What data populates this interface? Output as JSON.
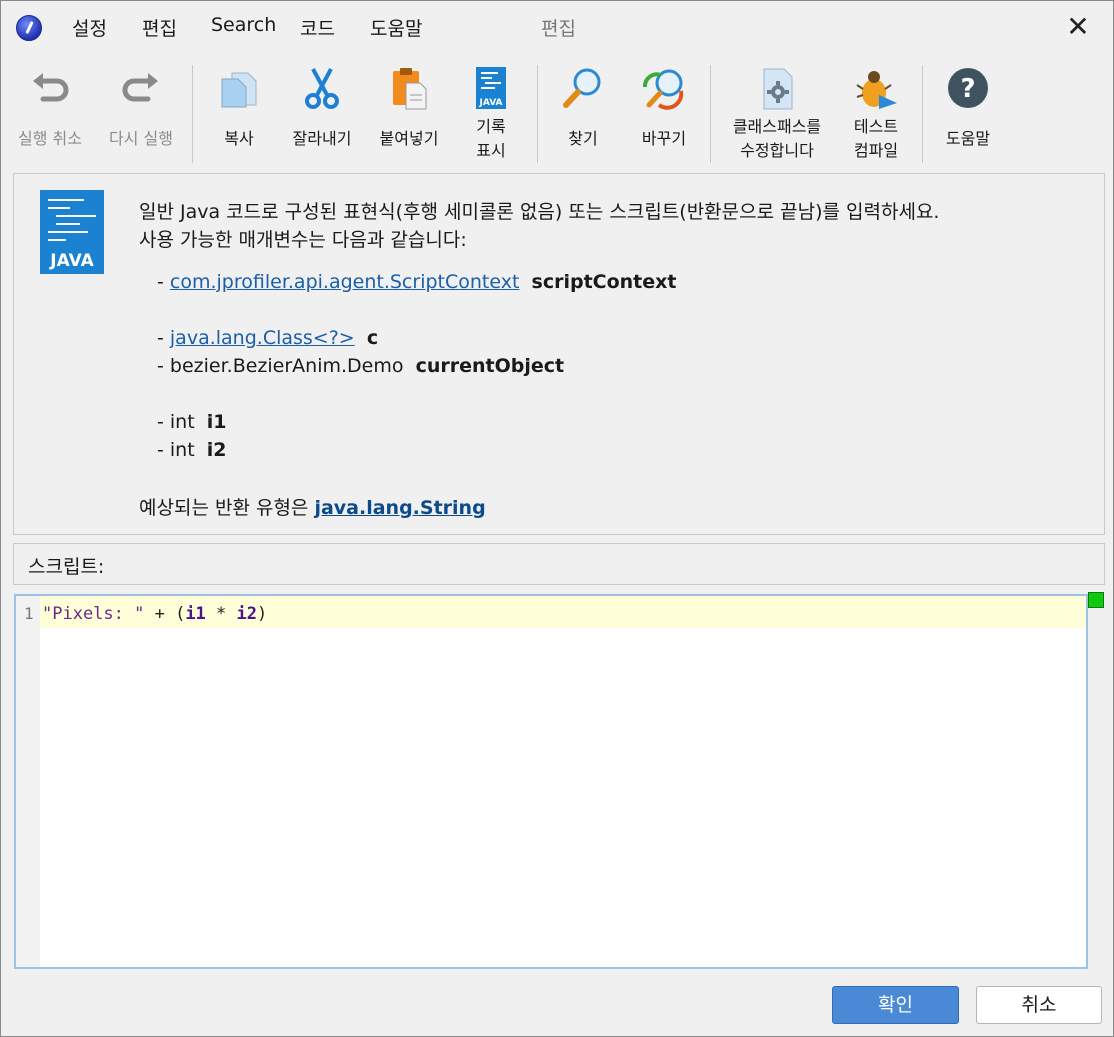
{
  "menu": {
    "items": [
      "설정",
      "편집",
      "Search",
      "코드",
      "도움말"
    ],
    "title": "편집"
  },
  "toolbar": {
    "undo": "실행 취소",
    "redo": "다시 실행",
    "copy": "복사",
    "cut": "잘라내기",
    "paste": "붙여넣기",
    "history_1": "기록",
    "history_2": "표시",
    "find": "찾기",
    "replace": "바꾸기",
    "classpath_1": "클래스패스를",
    "classpath_2": "수정합니다",
    "compile_1": "테스트",
    "compile_2": "컴파일",
    "help": "도움말",
    "java_icon_text": "JAVA"
  },
  "info": {
    "java_badge": "JAVA",
    "line1": "일반 Java 코드로 구성된 표현식(후행 세미콜론 없음) 또는 스크립트(반환문으로 끝남)를 입력하세요.",
    "line2": "사용 가능한 매개변수는 다음과 같습니다:",
    "params": [
      {
        "type": "com.jprofiler.api.agent.ScriptContext",
        "name": "scriptContext"
      },
      {
        "type": "java.lang.Class<?>",
        "name": "c"
      },
      {
        "type": "bezier.BezierAnim.Demo",
        "name": "currentObject"
      },
      {
        "type": "int",
        "name": "i1"
      },
      {
        "type": "int",
        "name": "i2"
      }
    ],
    "return_prefix": "예상되는 반환 유형은",
    "return_type": "java.lang.String"
  },
  "script": {
    "label": "스크립트:",
    "line_number": "1",
    "code_str": "\"Pixels: \"",
    "code_op1": " + (",
    "code_var1": "i1",
    "code_op2": " * ",
    "code_var2": "i2",
    "code_op3": ")"
  },
  "buttons": {
    "ok": "확인",
    "cancel": "취소"
  },
  "colors": {
    "accent": "#4a89d6",
    "link": "#1a5fa8",
    "status_ok": "#12c912"
  }
}
